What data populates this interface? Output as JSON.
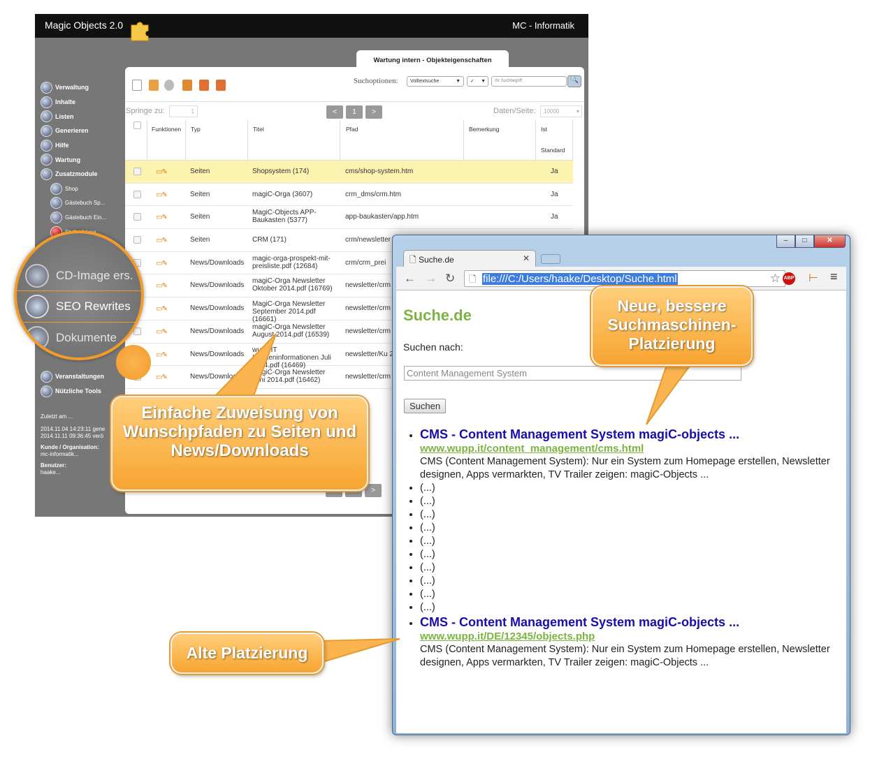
{
  "app": {
    "title": "Magic Objects 2.0",
    "company": "MC - Informatik",
    "tab": "Wartung intern - Objekteigenschaften",
    "sidebar": [
      {
        "label": "Verwaltung",
        "sub": false
      },
      {
        "label": "Inhalte",
        "sub": false
      },
      {
        "label": "Listen",
        "sub": false
      },
      {
        "label": "Generieren",
        "sub": false
      },
      {
        "label": "Hilfe",
        "sub": false
      },
      {
        "label": "Wartung",
        "sub": false
      },
      {
        "label": "Zusatzmodule",
        "sub": false
      },
      {
        "label": "Shop",
        "sub": true
      },
      {
        "label": "Gästebuch Sp...",
        "sub": true
      },
      {
        "label": "Gästebuch Ein...",
        "sub": true
      },
      {
        "label": "Stellenbörse",
        "sub": true
      }
    ],
    "sidebar_bottom": [
      {
        "label": "Veranstaltungen"
      },
      {
        "label": "Nützliche Tools"
      }
    ],
    "info": {
      "last_label": "Zuletzt am ...",
      "last1": "2014.11.04 14:23:11 gene",
      "last2": "2014.11.11 09:36:45 verö",
      "org_label": "Kunde / Organisation:",
      "org": "mc-informatik...",
      "user_label": "Benutzer:",
      "user": "haake..."
    },
    "zoom_items": [
      "CD-Image ers.",
      "SEO Rewrites",
      "Dokumente"
    ],
    "toolbar": {
      "search_label": "Suchoptionen:",
      "mode": "Volltextsuche",
      "check": "✓",
      "placeholder": "Ihr Suchbegriff"
    },
    "pager": {
      "jump_label": "Springe zu:",
      "jump_value": "1",
      "page": "1",
      "prev": "<",
      "next": ">",
      "per_page_label": "Daten/Seite:",
      "per_page": "10000"
    },
    "columns": [
      "Funktionen",
      "Typ",
      "Titel",
      "Pfad",
      "Bemerkung",
      "Ist",
      "Standard"
    ],
    "rows": [
      {
        "typ": "Seiten",
        "titel": "Shopsystem (174)",
        "pfad": "cms/shop-system.htm",
        "std": "Ja"
      },
      {
        "typ": "Seiten",
        "titel": "magiC-Orga (3607)",
        "pfad": "crm_dms/crm.htm",
        "std": "Ja"
      },
      {
        "typ": "Seiten",
        "titel": "MagiC-Objects APP-Baukasten (5377)",
        "pfad": "app-baukasten/app.htm",
        "std": "Ja"
      },
      {
        "typ": "Seiten",
        "titel": "CRM (171)",
        "pfad": "crm/newsletter",
        "std": ""
      },
      {
        "typ": "News/Downloads",
        "titel": "magic-orga-prospekt-mit-preisliste.pdf (12684)",
        "pfad": "crm/crm_prei",
        "std": ""
      },
      {
        "typ": "News/Downloads",
        "titel": "magiC-Orga Newsletter Oktober 2014.pdf (16769)",
        "pfad": "newsletter/crm 2014.pdf",
        "std": ""
      },
      {
        "typ": "News/Downloads",
        "titel": "MagiC-Orga Newsletter September 2014.pdf (16661)",
        "pfad": "newsletter/crm orga_septemb",
        "std": ""
      },
      {
        "typ": "News/Downloads",
        "titel": "magiC-Orga Newsletter August 2014.pdf (16539)",
        "pfad": "newsletter/crm 2014.pdf",
        "std": ""
      },
      {
        "typ": "News/Downloads",
        "titel": "wupp.IT Kundeninformationen Juli 2014.pdf (16469)",
        "pfad": "newsletter/Ku 2014.pdf",
        "std": ""
      },
      {
        "typ": "News/Downloads",
        "titel": "MagiC-Orga Newsletter Juni 2014.pdf (16462)",
        "pfad": "newsletter/crm 2014.pdf",
        "std": ""
      }
    ]
  },
  "browser": {
    "tab_title": "Suche.de",
    "url": "file:///C:/Users/haake/Desktop/Suche.html",
    "site_title": "Suche.de",
    "search_label": "Suchen nach:",
    "query": "Content Management System",
    "button": "Suchen",
    "result1": {
      "title": "CMS - Content Management System magiC-objects ...",
      "url": "www.wupp.it/content_management/cms.html",
      "desc": "CMS (Content Management System): Nur ein System zum Homepage erstellen, Newsletter designen, Apps vermarkten, TV Trailer zeigen: magiC-Objects ..."
    },
    "ellipsis": [
      "(...)",
      "(...)",
      "(...)",
      "(...)",
      "(...)",
      "(...)",
      "(...)",
      "(...)",
      "(...)",
      "(...)"
    ],
    "result2": {
      "title": "CMS - Content Management System magiC-objects ...",
      "url": "www.wupp.it/DE/12345/objects.php",
      "desc": "CMS (Content Management System): Nur ein System zum Homepage erstellen, Newsletter designen, Apps vermarkten, TV Trailer zeigen: magiC-Objects ..."
    }
  },
  "callouts": {
    "paths": "Einfache Zuweisung von Wunschpfaden zu Seiten und News/Downloads",
    "new": "Neue, bessere Suchmaschinen-Platzierung",
    "old": "Alte Platzierung"
  },
  "colors": {
    "accent": "#f7a430",
    "site_green": "#7cb342",
    "link_blue": "#1a0dab",
    "row_highlight": "#fdf3b0"
  }
}
